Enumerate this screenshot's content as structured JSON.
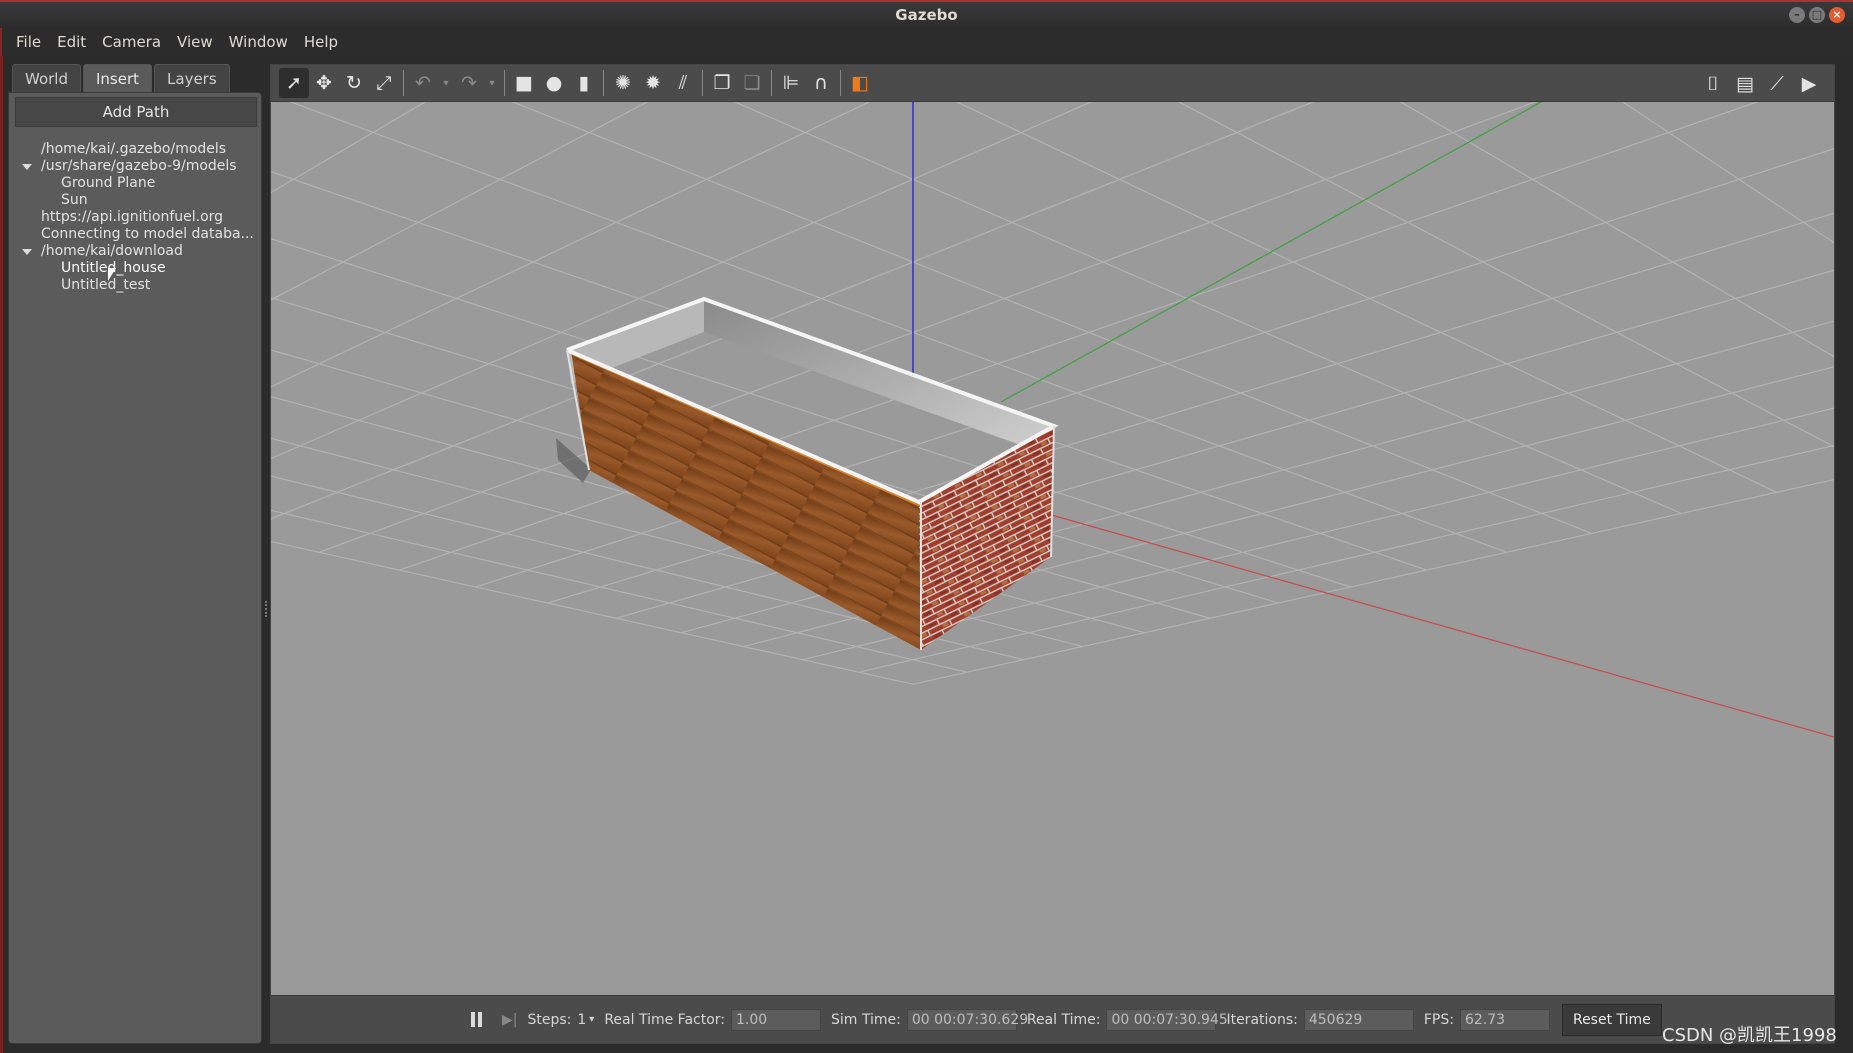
{
  "window": {
    "title": "Gazebo"
  },
  "menubar": {
    "items": [
      "File",
      "Edit",
      "Camera",
      "View",
      "Window",
      "Help"
    ]
  },
  "left_panel": {
    "tabs": [
      "World",
      "Insert",
      "Layers"
    ],
    "active_tab": "Insert",
    "add_path_label": "Add Path",
    "tree": [
      {
        "label": "/home/kai/.gazebo/models",
        "level": 0,
        "expanded": false
      },
      {
        "label": "/usr/share/gazebo-9/models",
        "level": 0,
        "expanded": true
      },
      {
        "label": "Ground Plane",
        "level": 1
      },
      {
        "label": "Sun",
        "level": 1
      },
      {
        "label": "https://api.ignitionfuel.org",
        "level": 0,
        "expanded": false
      },
      {
        "label": "Connecting to model databa...",
        "level": 0,
        "expanded": false
      },
      {
        "label": "/home/kai/download",
        "level": 0,
        "expanded": true
      },
      {
        "label": "Untitled_house",
        "level": 1,
        "selected": true
      },
      {
        "label": "Untitled_test",
        "level": 1
      }
    ]
  },
  "toolbar": {
    "left_tools": [
      "select-arrow",
      "translate",
      "rotate",
      "scale",
      "undo",
      "redo",
      "box",
      "sphere",
      "cylinder",
      "point-light",
      "spot-light",
      "directional-light",
      "copy",
      "paste",
      "align",
      "snap",
      "view-angle"
    ],
    "right_tools": [
      "screenshot",
      "log",
      "plot",
      "video-record"
    ]
  },
  "bottom_bar": {
    "steps_label": "Steps:",
    "steps_value": "1",
    "rtf_label": "Real Time Factor:",
    "rtf_value": "1.00",
    "sim_time_label": "Sim Time:",
    "sim_time_value": "00 00:07:30.629",
    "real_time_label": "Real Time:",
    "real_time_value": "00 00:07:30.945",
    "iterations_label": "Iterations:",
    "iterations_value": "450629",
    "fps_label": "FPS:",
    "fps_value": "62.73",
    "reset_label": "Reset Time"
  },
  "watermark": "CSDN @凯凯王1998",
  "colors": {
    "viewport_bg": "#9a9a9a",
    "grid": "#b4b4b4",
    "axis_x": "#c84a4a",
    "axis_y": "#3fa03f",
    "axis_z": "#3030c8",
    "wood": "#8b4a1e",
    "brick": "#9b3b2b",
    "wall_inner": "#a8a8a8"
  }
}
